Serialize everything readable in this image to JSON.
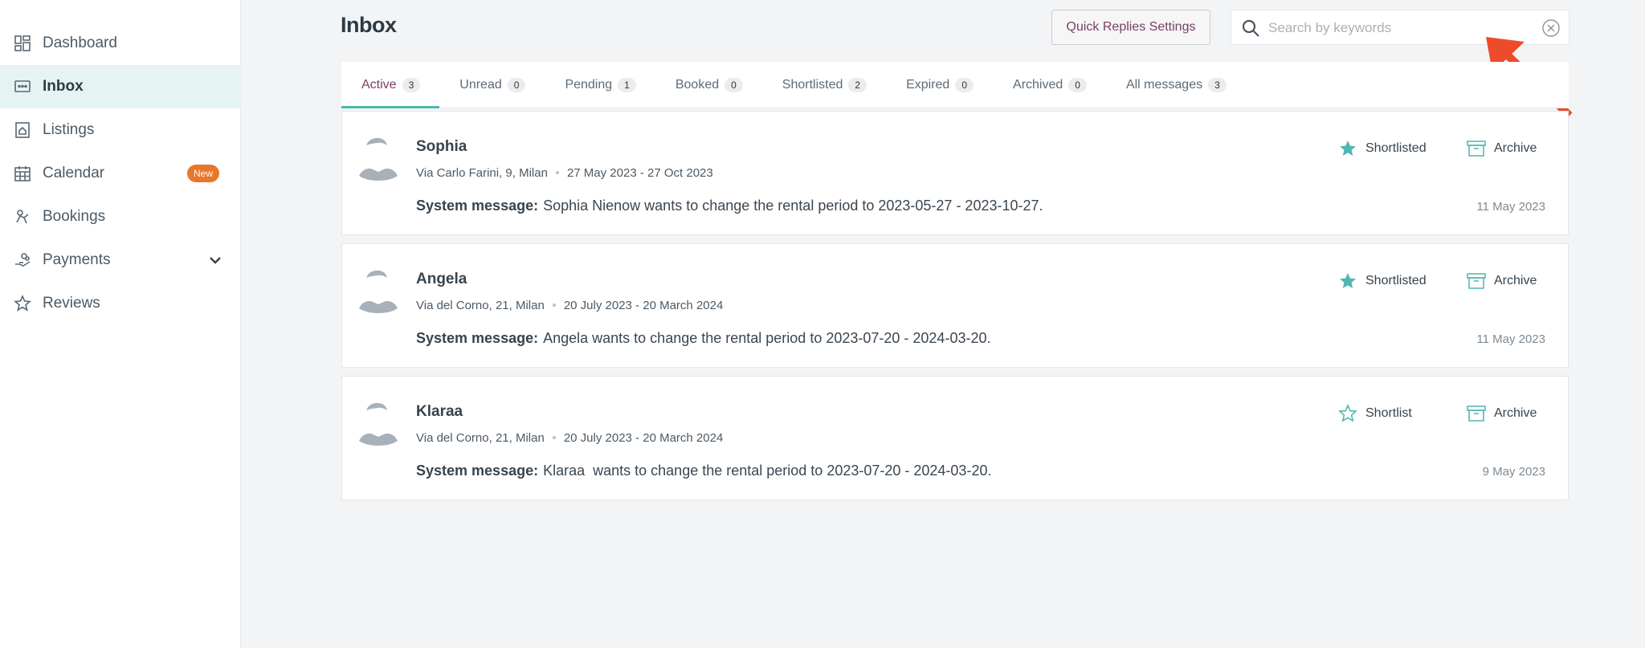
{
  "sidebar": {
    "items": [
      {
        "label": "Dashboard",
        "icon": "dashboard-icon"
      },
      {
        "label": "Inbox",
        "icon": "inbox-icon",
        "active": true
      },
      {
        "label": "Listings",
        "icon": "listings-icon"
      },
      {
        "label": "Calendar",
        "icon": "calendar-icon",
        "badge": "New"
      },
      {
        "label": "Bookings",
        "icon": "bookings-icon"
      },
      {
        "label": "Payments",
        "icon": "payments-icon"
      },
      {
        "label": "Reviews",
        "icon": "star-icon"
      }
    ]
  },
  "header": {
    "title": "Inbox",
    "quick_replies_label": "Quick Replies Settings",
    "search_placeholder": "Search by keywords"
  },
  "tabs": [
    {
      "label": "Active",
      "count": "3"
    },
    {
      "label": "Unread",
      "count": "0"
    },
    {
      "label": "Pending",
      "count": "1"
    },
    {
      "label": "Booked",
      "count": "0"
    },
    {
      "label": "Shortlisted",
      "count": "2"
    },
    {
      "label": "Expired",
      "count": "0"
    },
    {
      "label": "Archived",
      "count": "0"
    },
    {
      "label": "All messages",
      "count": "3"
    }
  ],
  "conversations": [
    {
      "name": "Sophia",
      "address": "Via Carlo Farini, 9, Milan",
      "period": "27 May 2023 - 27 Oct 2023",
      "message_prefix": "System message:",
      "message": "Sophia Nienow wants to change the rental period to 2023-05-27 - 2023-10-27.",
      "date": "11 May 2023",
      "shortlist_label": "Shortlisted",
      "archive_label": "Archive"
    },
    {
      "name": "Angela",
      "address": "Via del Corno, 21, Milan",
      "period": "20 July 2023 - 20 March 2024",
      "message_prefix": "System message:",
      "message": "Angela wants to change the rental period to 2023-07-20 - 2024-03-20.",
      "date": "11 May 2023",
      "shortlist_label": "Shortlisted",
      "archive_label": "Archive"
    },
    {
      "name": "Klaraa",
      "address": "Via del Corno, 21, Milan",
      "period": "20 July 2023 - 20 March 2024",
      "message_prefix": "System message:",
      "message": "Klaraa  wants to change the rental period to 2023-07-20 - 2024-03-20.",
      "date": "9 May 2023",
      "shortlist_label": "Shortlist",
      "archive_label": "Archive"
    }
  ],
  "colors": {
    "accent": "#4fb6b0",
    "tab_active_text": "#7a3f66",
    "badge_new": "#e8762b",
    "arrow": "#ee4b2b"
  }
}
